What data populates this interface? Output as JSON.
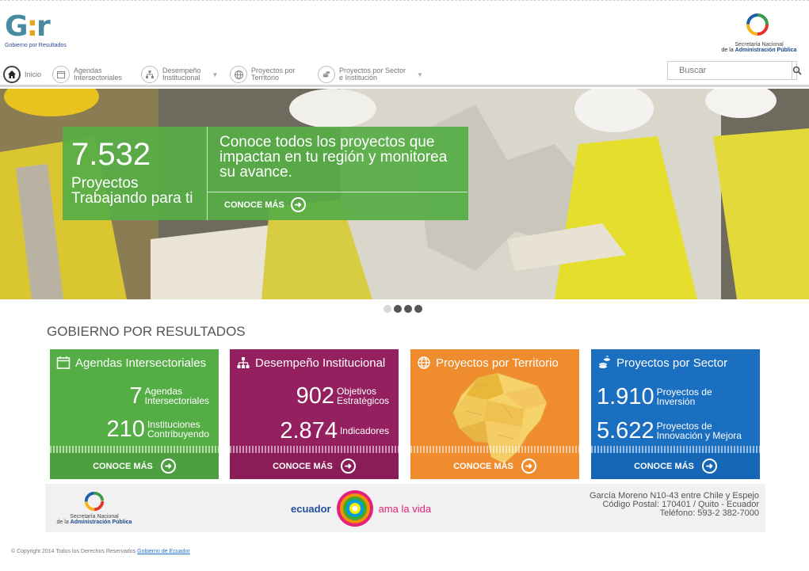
{
  "header": {
    "logo_text": "G:r",
    "logo_sub": "Gobierno por Resultados",
    "snap_line1": "Secretaría Nacional",
    "snap_line2_prefix": "de la ",
    "snap_line2_bold": "Administración Pública"
  },
  "nav": {
    "items": [
      {
        "label": "Inicio",
        "icon": "home-icon"
      },
      {
        "label": "Agendas\nIntersectoriales",
        "icon": "calendar-icon"
      },
      {
        "label": "Desempeño\nInstitucional",
        "icon": "org-chart-icon"
      },
      {
        "label": "Proyectos por\nTerritorio",
        "icon": "globe-icon"
      },
      {
        "label": "Proyectos por Sector\ne Institución",
        "icon": "coins-icon"
      }
    ],
    "search_placeholder": "Buscar"
  },
  "hero": {
    "number": "7.532",
    "number_label": "Proyectos\nTrabajando para ti",
    "text": "Conoce todos los proyectos que impactan en tu región y monitorea su avance.",
    "more": "CONOCE MÁS",
    "dots_total": 4,
    "dot_active": 1
  },
  "section": {
    "title": "GOBIERNO POR RESULTADOS"
  },
  "cards": [
    {
      "title": "Agendas Intersectoriales",
      "stats": [
        {
          "n": "7",
          "l": "Agendas\nIntersectoriales"
        },
        {
          "n": "210",
          "l": "Instituciones\nContribuyendo"
        }
      ],
      "more": "CONOCE MÁS"
    },
    {
      "title": "Desempeño Institucional",
      "stats": [
        {
          "n": "902",
          "l": "Objetivos\nEstratégicos"
        },
        {
          "n": "2.874",
          "l": "Indicadores"
        }
      ],
      "more": "CONOCE MÁS"
    },
    {
      "title": "Proyectos por Territorio",
      "more": "CONOCE MÁS"
    },
    {
      "title": "Proyectos por Sector",
      "stats": [
        {
          "n": "1.910",
          "l": "Proyectos de\nInversión"
        },
        {
          "n": "5.622",
          "l": "Proyectos de\nInnovación y Mejora"
        }
      ],
      "more": "CONOCE MÁS"
    }
  ],
  "footer": {
    "snap_line1": "Secretaría Nacional",
    "snap_line2_prefix": "de la ",
    "snap_line2_bold": "Administración Pública",
    "ecuador_left": "ecuador",
    "ecuador_right": "ama la vida",
    "address1": "García Moreno N10-43 entre Chile y Espejo",
    "address2": "Código Postal: 170401 / Quito - Ecuador",
    "address3": "Teléfono: 593-2 382-7000",
    "copyright_text": "© Copyright 2014 Todos los Derechos Reservados ",
    "copyright_link": "Gobierno de Ecuador"
  },
  "colors": {
    "green": "#55ad46",
    "purple": "#94205f",
    "orange": "#ef8c2e",
    "blue": "#1b6fc0"
  }
}
